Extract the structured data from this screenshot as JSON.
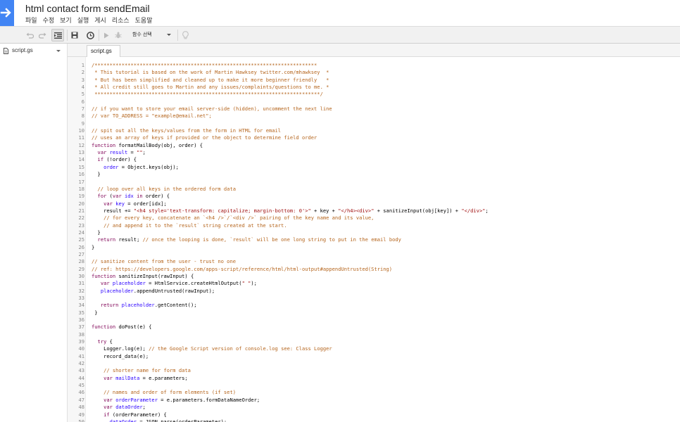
{
  "app": {
    "title": "html contact form sendEmail",
    "menu": [
      "파일",
      "수정",
      "보기",
      "실행",
      "게시",
      "리소스",
      "도움말"
    ]
  },
  "toolbar": {
    "function_select": "함수 선택",
    "icons": [
      "undo-icon",
      "redo-icon",
      "indent-icon",
      "save-icon",
      "triggers-clock-icon",
      "run-icon",
      "debug-bug-icon",
      "lightbulb-icon"
    ]
  },
  "sidebar": {
    "files": [
      {
        "name": "script.gs"
      }
    ]
  },
  "tabs": [
    {
      "label": "script.gs"
    }
  ],
  "editor": {
    "lines": [
      {
        "n": "1",
        "t": [
          [
            "c",
            "/**************************************************************************"
          ]
        ]
      },
      {
        "n": "2",
        "t": [
          [
            "c",
            " * This tutorial is based on the work of Martin Hawksey twitter.com/mhawksey  *"
          ]
        ]
      },
      {
        "n": "3",
        "t": [
          [
            "c",
            " * But has been simplified and cleaned up to make it more beginner friendly   *"
          ]
        ]
      },
      {
        "n": "4",
        "t": [
          [
            "c",
            " * All credit still goes to Martin and any issues/complaints/questions to me. *"
          ]
        ]
      },
      {
        "n": "5",
        "t": [
          [
            "c",
            " ***************************************************************************/"
          ]
        ]
      },
      {
        "n": "6",
        "t": []
      },
      {
        "n": "7",
        "t": [
          [
            "c",
            "// if you want to store your email server-side (hidden), uncomment the next line"
          ]
        ]
      },
      {
        "n": "8",
        "t": [
          [
            "c",
            "// var TO_ADDRESS = \"example@email.net\";"
          ]
        ]
      },
      {
        "n": "9",
        "t": []
      },
      {
        "n": "10",
        "t": [
          [
            "c",
            "// spit out all the keys/values from the form in HTML for email"
          ]
        ]
      },
      {
        "n": "11",
        "t": [
          [
            "c",
            "// uses an array of keys if provided or the object to determine field order"
          ]
        ]
      },
      {
        "n": "12",
        "t": [
          [
            "k",
            "function"
          ],
          [
            "p",
            " formatMailBody(obj, order) {"
          ]
        ]
      },
      {
        "n": "13",
        "t": [
          [
            "p",
            "  "
          ],
          [
            "k",
            "var"
          ],
          [
            "p",
            " "
          ],
          [
            "v",
            "result"
          ],
          [
            "p",
            " = "
          ],
          [
            "s",
            "\"\""
          ],
          [
            "p",
            ";"
          ]
        ]
      },
      {
        "n": "14",
        "t": [
          [
            "p",
            "  "
          ],
          [
            "k",
            "if"
          ],
          [
            "p",
            " (!order) {"
          ]
        ]
      },
      {
        "n": "15",
        "t": [
          [
            "p",
            "    "
          ],
          [
            "v",
            "order"
          ],
          [
            "p",
            " = Object.keys(obj);"
          ]
        ]
      },
      {
        "n": "16",
        "t": [
          [
            "p",
            "  }"
          ]
        ]
      },
      {
        "n": "17",
        "t": []
      },
      {
        "n": "18",
        "t": [
          [
            "c",
            "  // loop over all keys in the ordered form data"
          ]
        ]
      },
      {
        "n": "19",
        "t": [
          [
            "p",
            "  "
          ],
          [
            "k",
            "for"
          ],
          [
            "p",
            " ("
          ],
          [
            "k",
            "var"
          ],
          [
            "p",
            " "
          ],
          [
            "v",
            "idx"
          ],
          [
            "p",
            " "
          ],
          [
            "k",
            "in"
          ],
          [
            "p",
            " order) {"
          ]
        ]
      },
      {
        "n": "20",
        "t": [
          [
            "p",
            "    "
          ],
          [
            "k",
            "var"
          ],
          [
            "p",
            " "
          ],
          [
            "v",
            "key"
          ],
          [
            "p",
            " = order[idx];"
          ]
        ]
      },
      {
        "n": "21",
        "t": [
          [
            "p",
            "    result += "
          ],
          [
            "s",
            "\"<h4 style='text-transform: capitalize; margin-bottom: 0'>\""
          ],
          [
            "p",
            " + key + "
          ],
          [
            "s",
            "\"</h4><div>\""
          ],
          [
            "p",
            " + sanitizeInput(obj[key]) + "
          ],
          [
            "s",
            "\"</div>\""
          ],
          [
            "p",
            ";"
          ]
        ]
      },
      {
        "n": "22",
        "t": [
          [
            "c",
            "    // for every key, concatenate an `<h4 />`/`<div />` pairing of the key name and its value,"
          ]
        ]
      },
      {
        "n": "23",
        "t": [
          [
            "c",
            "    // and append it to the `result` string created at the start."
          ]
        ]
      },
      {
        "n": "24",
        "t": [
          [
            "p",
            "  }"
          ]
        ]
      },
      {
        "n": "25",
        "t": [
          [
            "p",
            "  "
          ],
          [
            "k",
            "return"
          ],
          [
            "p",
            " result; "
          ],
          [
            "c",
            "// once the looping is done, `result` will be one long string to put in the email body"
          ]
        ]
      },
      {
        "n": "26",
        "t": [
          [
            "p",
            "}"
          ]
        ]
      },
      {
        "n": "27",
        "t": []
      },
      {
        "n": "28",
        "t": [
          [
            "c",
            "// sanitize content from the user - trust no one"
          ]
        ]
      },
      {
        "n": "29",
        "t": [
          [
            "c",
            "// ref: https://developers.google.com/apps-script/reference/html/html-output#appendUntrusted(String)"
          ]
        ]
      },
      {
        "n": "30",
        "t": [
          [
            "k",
            "function"
          ],
          [
            "p",
            " sanitizeInput(rawInput) {"
          ]
        ]
      },
      {
        "n": "31",
        "t": [
          [
            "p",
            "   "
          ],
          [
            "k",
            "var"
          ],
          [
            "p",
            " "
          ],
          [
            "v",
            "placeholder"
          ],
          [
            "p",
            " = HtmlService.createHtmlOutput("
          ],
          [
            "s",
            "\" \""
          ],
          [
            "p",
            ");"
          ]
        ]
      },
      {
        "n": "32",
        "t": [
          [
            "p",
            "   "
          ],
          [
            "v",
            "placeholder"
          ],
          [
            "p",
            ".appendUntrusted(rawInput);"
          ]
        ]
      },
      {
        "n": "33",
        "t": []
      },
      {
        "n": "34",
        "t": [
          [
            "p",
            "   "
          ],
          [
            "k",
            "return"
          ],
          [
            "p",
            " "
          ],
          [
            "v",
            "placeholder"
          ],
          [
            "p",
            ".getContent();"
          ]
        ]
      },
      {
        "n": "35",
        "t": [
          [
            "p",
            " }"
          ]
        ]
      },
      {
        "n": "36",
        "t": []
      },
      {
        "n": "37",
        "t": [
          [
            "k",
            "function"
          ],
          [
            "p",
            " doPost(e) {"
          ]
        ]
      },
      {
        "n": "38",
        "t": []
      },
      {
        "n": "39",
        "t": [
          [
            "p",
            "  "
          ],
          [
            "k",
            "try"
          ],
          [
            "p",
            " {"
          ]
        ]
      },
      {
        "n": "40",
        "t": [
          [
            "p",
            "    Logger.log(e); "
          ],
          [
            "c",
            "// the Google Script version of console.log see: Class Logger"
          ]
        ]
      },
      {
        "n": "41",
        "t": [
          [
            "p",
            "    record_data(e);"
          ]
        ]
      },
      {
        "n": "42",
        "t": []
      },
      {
        "n": "43",
        "t": [
          [
            "c",
            "    // shorter name for form data"
          ]
        ]
      },
      {
        "n": "44",
        "t": [
          [
            "p",
            "    "
          ],
          [
            "k",
            "var"
          ],
          [
            "p",
            " "
          ],
          [
            "v",
            "mailData"
          ],
          [
            "p",
            " = e.parameters;"
          ]
        ]
      },
      {
        "n": "45",
        "t": []
      },
      {
        "n": "46",
        "t": [
          [
            "c",
            "    // names and order of form elements (if set)"
          ]
        ]
      },
      {
        "n": "47",
        "t": [
          [
            "p",
            "    "
          ],
          [
            "k",
            "var"
          ],
          [
            "p",
            " "
          ],
          [
            "v",
            "orderParameter"
          ],
          [
            "p",
            " = e.parameters.formDataNameOrder;"
          ]
        ]
      },
      {
        "n": "48",
        "t": [
          [
            "p",
            "    "
          ],
          [
            "k",
            "var"
          ],
          [
            "p",
            " "
          ],
          [
            "v",
            "dataOrder"
          ],
          [
            "p",
            ";"
          ]
        ]
      },
      {
        "n": "49",
        "t": [
          [
            "p",
            "    "
          ],
          [
            "k",
            "if"
          ],
          [
            "p",
            " (orderParameter) {"
          ]
        ]
      },
      {
        "n": "50",
        "t": [
          [
            "p",
            "      "
          ],
          [
            "v",
            "dataOrder"
          ],
          [
            "p",
            " = JSON.parse(orderParameter);"
          ]
        ]
      }
    ]
  },
  "colors": {
    "brand": "#4285f4",
    "comment": "#b5651d",
    "keyword": "#7f0055",
    "string": "#a01010",
    "variable": "#2a00ff"
  }
}
